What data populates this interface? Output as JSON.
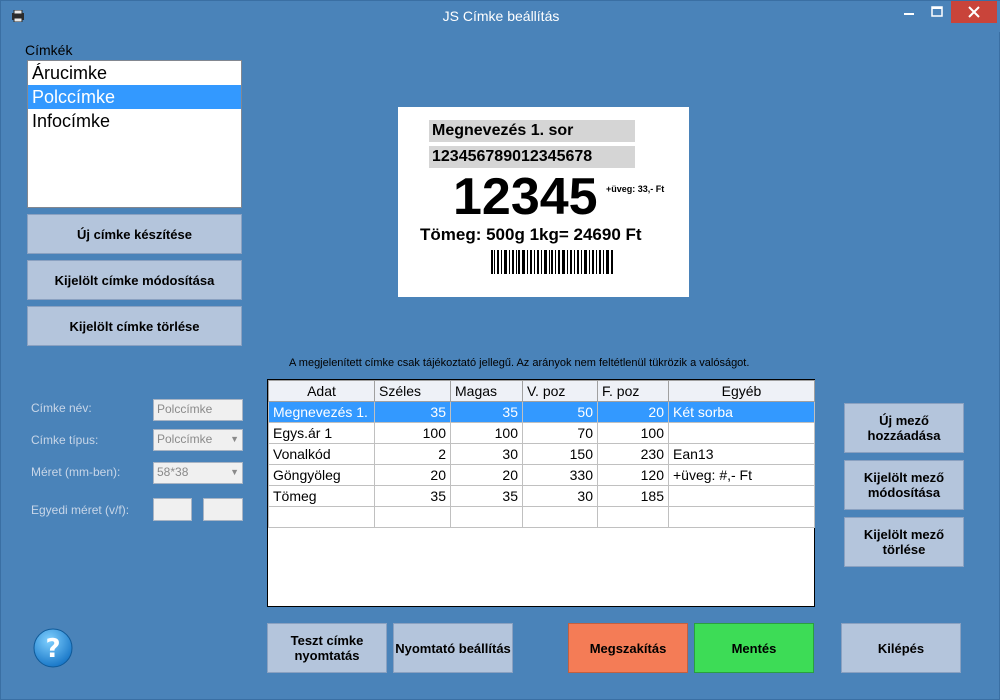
{
  "window": {
    "title": "JS Címke beállítás"
  },
  "labels_list": {
    "caption": "Címkék",
    "items": [
      "Árucimke",
      "Polccímke",
      "Infocímke"
    ],
    "selected_index": 1
  },
  "label_buttons": {
    "new": "Új címke készítése",
    "modify": "Kijelölt címke módosítása",
    "delete": "Kijelölt címke törlése"
  },
  "preview": {
    "name": "Megnevezés 1. sor",
    "code": "123456789012345678",
    "price": "12345",
    "extra": "+üveg: 33,- Ft",
    "weight": "Tömeg: 500g 1kg= 24690 Ft"
  },
  "note": "A megjelenített címke csak tájékoztató jellegű.  Az arányok nem feltétlenül tükrözik a valóságot.",
  "form": {
    "name_label": "Címke név:",
    "name_value": "Polccímke",
    "type_label": "Címke típus:",
    "type_value": "Polccímke",
    "size_label": "Méret (mm-ben):",
    "size_value": "58*38",
    "custom_label": "Egyedi méret (v/f):"
  },
  "fields_table": {
    "headers": [
      "Adat",
      "Széles",
      "Magas",
      "V. poz",
      "F. poz",
      "Egyéb"
    ],
    "rows": [
      [
        "Megnevezés 1.",
        "35",
        "35",
        "50",
        "20",
        "Két sorba"
      ],
      [
        "Egys.ár 1",
        "100",
        "100",
        "70",
        "100",
        ""
      ],
      [
        "Vonalkód",
        "2",
        "30",
        "150",
        "230",
        "Ean13"
      ],
      [
        "Göngyöleg",
        "20",
        "20",
        "330",
        "120",
        "+üveg: #,- Ft"
      ],
      [
        "Tömeg",
        "35",
        "35",
        "30",
        "185",
        ""
      ],
      [
        "",
        "",
        "",
        "",
        "",
        ""
      ]
    ],
    "selected_row": 0
  },
  "field_buttons": {
    "add": "Új mező hozzáadása",
    "modify": "Kijelölt mező módosítása",
    "delete": "Kijelölt mező törlése"
  },
  "bottom_buttons": {
    "test_print": "Teszt címke nyomtatás",
    "printer_settings": "Nyomtató beállítás",
    "cancel": "Megszakítás",
    "save": "Mentés",
    "exit": "Kilépés"
  },
  "colors": {
    "window_bg": "#4a83b9",
    "button_bg": "#b4c5dc",
    "cancel_bg": "#f47c56",
    "save_bg": "#3ddc56",
    "selection": "#3399ff"
  }
}
